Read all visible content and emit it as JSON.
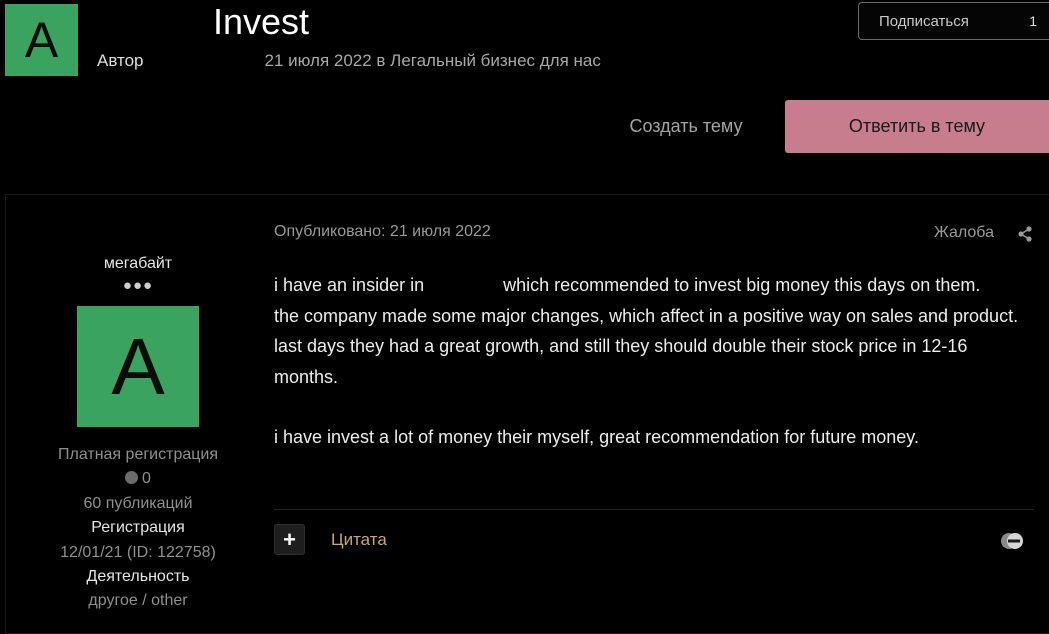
{
  "topic": {
    "avatar_letter": "A",
    "title": "Invest",
    "author_prefix": "Автор",
    "meta": "21 июля 2022 в Легальный бизнес для нас"
  },
  "subscribe": {
    "label": "Подписаться",
    "count": "1"
  },
  "actions": {
    "create_topic": "Создать тему",
    "reply": "Ответить в тему"
  },
  "author": {
    "name": "мегабайт",
    "rank_dots": "●●●",
    "avatar_letter": "A",
    "group": "Платная регистрация",
    "reputation": "0",
    "posts": "60 публикаций",
    "registration_label": "Регистрация",
    "registration_value": "12/01/21 (ID: 122758)",
    "activity_label": "Деятельность",
    "activity_value": "другое / other"
  },
  "post": {
    "published": "Опубликовано: 21 июля 2022",
    "report": "Жалоба",
    "line1_a": "i have an insider in",
    "line1_b": "which recommended to invest big money this days on them.",
    "line2": "the company made some major changes, which affect in a positive way on sales and product.",
    "line3": "last days they had a great growth, and still they should double their stock price in 12-16 months.",
    "line4": "i have invest a lot of money their myself, great recommendation for future money."
  },
  "footer": {
    "plus": "+",
    "quote": "Цитата"
  },
  "colors": {
    "avatar": "#3aa35f",
    "reply_button": "#c77d8e",
    "quote_link": "#c9a86d"
  }
}
